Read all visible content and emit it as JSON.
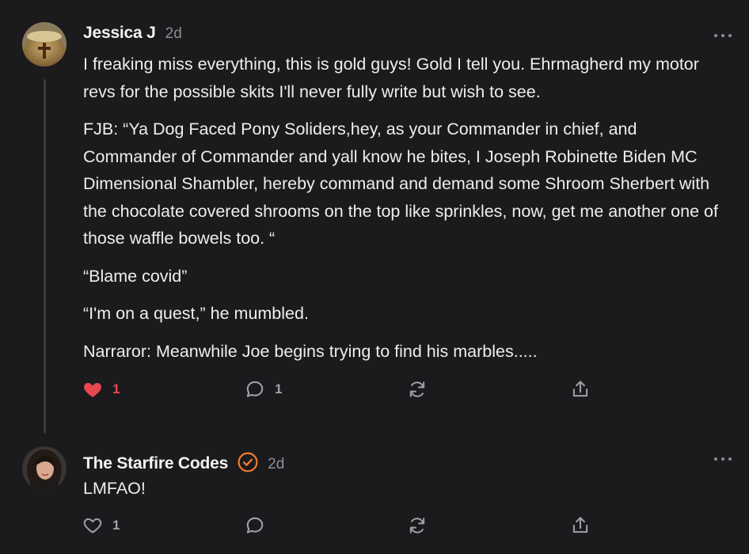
{
  "comments": [
    {
      "author": "Jessica J",
      "time": "2d",
      "paragraphs": [
        "I freaking miss everything, this is gold guys! Gold I tell you. Ehrmagherd my motor revs for the possible skits I'll never fully write but wish to see.",
        "FJB: “Ya Dog Faced Pony Soliders,hey, as your Commander in chief, and Commander of Commander and yall know he bites, I Joseph Robinette Biden MC Dimensional Shambler, hereby command and demand some Shroom Sherbert with the chocolate covered shrooms on the top like sprinkles, now, get me another one of those waffle bowels too. “",
        "“Blame covid”",
        "“I'm on a quest,” he mumbled.",
        "Narraror: Meanwhile Joe begins trying to find his marbles....."
      ],
      "likes": "1",
      "liked": true,
      "replies": "1"
    },
    {
      "author": "The Starfire Codes",
      "verified": true,
      "time": "2d",
      "paragraphs": [
        "LMFAO!"
      ],
      "likes": "1",
      "liked": false,
      "replies": ""
    }
  ],
  "colors": {
    "background": "#1b1b1d",
    "like_active": "#e8484e",
    "verified": "#f57c2a",
    "muted": "#8e8e93"
  },
  "icons": [
    "heart-icon",
    "comment-icon",
    "restack-icon",
    "share-icon",
    "more-icon",
    "verified-icon"
  ]
}
